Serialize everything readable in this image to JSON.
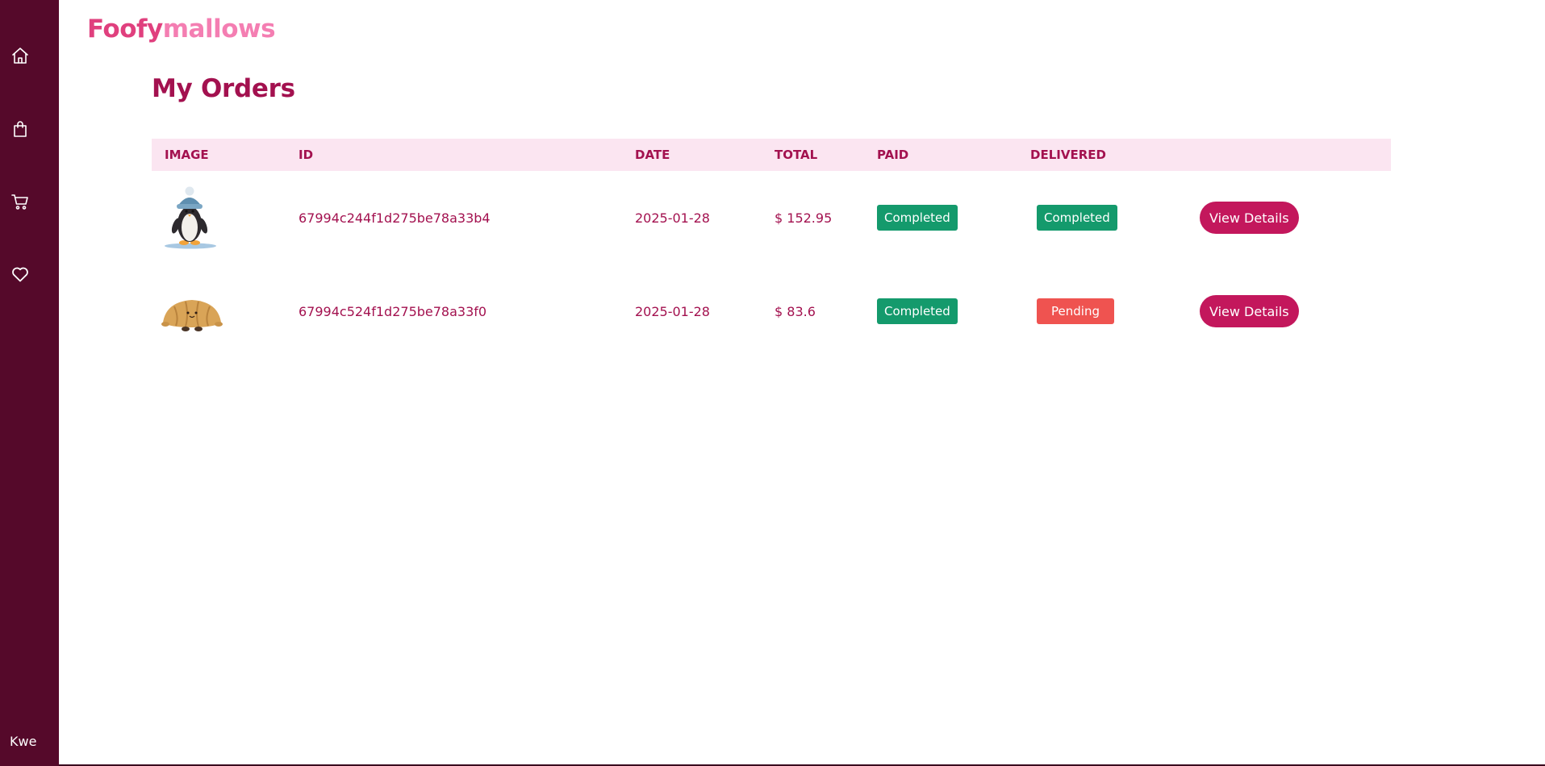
{
  "brand": {
    "part1": "Foofy",
    "part2": "mallows"
  },
  "sidebar": {
    "items": [
      {
        "icon": "home-icon"
      },
      {
        "icon": "shopping-bag-icon"
      },
      {
        "icon": "cart-icon"
      },
      {
        "icon": "heart-icon"
      }
    ],
    "user": "Kwe"
  },
  "page": {
    "title": "My Orders"
  },
  "table": {
    "headers": {
      "image": "IMAGE",
      "id": "ID",
      "date": "DATE",
      "total": "TOTAL",
      "paid": "PAID",
      "delivered": "DELIVERED"
    },
    "rows": [
      {
        "image": "penguin-plush-image",
        "id": "67994c244f1d275be78a33b4",
        "date": "2025-01-28",
        "total": "$ 152.95",
        "paid": "Completed",
        "delivered": "Completed",
        "action": "View Details"
      },
      {
        "image": "croissant-plush-image",
        "id": "67994c524f1d275be78a33f0",
        "date": "2025-01-28",
        "total": "$ 83.6",
        "paid": "Completed",
        "delivered": "Pending",
        "action": "View Details"
      }
    ]
  },
  "colors": {
    "sidebar": "#55092a",
    "accent": "#a3114f",
    "button": "#c3175c",
    "completed": "#149a6c",
    "pending": "#ef5350",
    "header_bg": "#fbe5f1"
  }
}
